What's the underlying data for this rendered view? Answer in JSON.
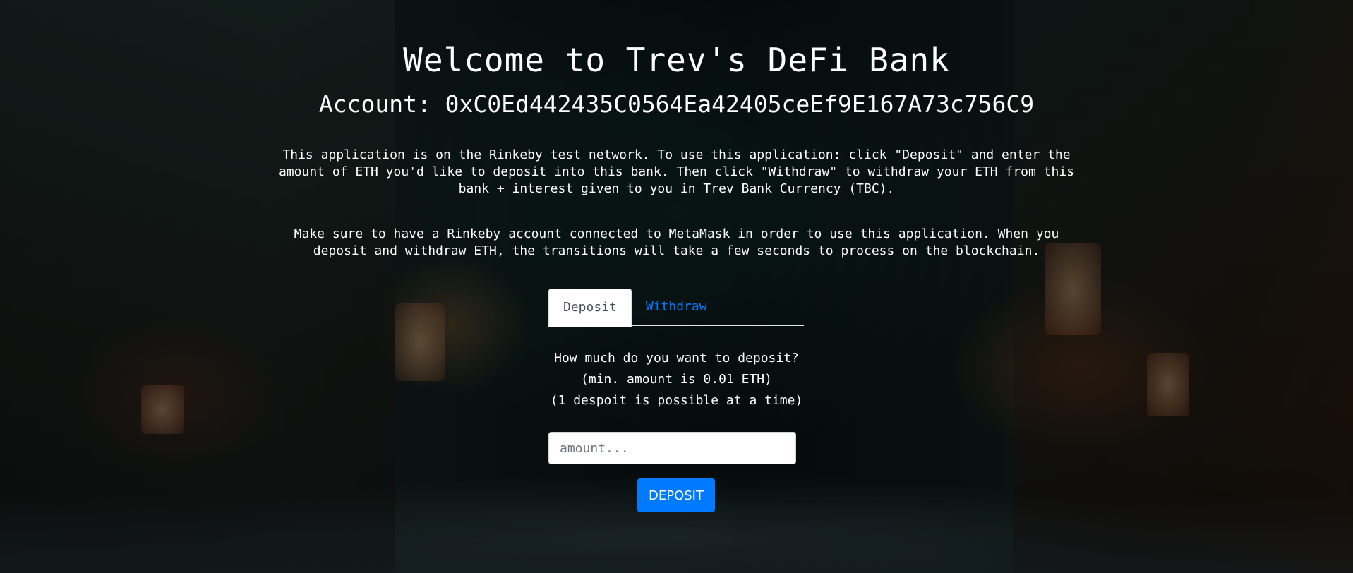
{
  "header": {
    "title": "Welcome to Trev's DeFi Bank",
    "account": "Account: 0xC0Ed442435C0564Ea42405ceEf9E167A73c756C9"
  },
  "info": {
    "paragraph1": "This application is on the Rinkeby test network. To use this application: click \"Deposit\" and enter the amount of ETH you'd like to deposit into this bank. Then click \"Withdraw\" to withdraw your ETH from this bank + interest given to you in Trev Bank Currency (TBC).",
    "paragraph2": "Make sure to have a Rinkeby account connected to MetaMask in order to use this application. When you deposit and withdraw ETH, the transitions will take a few seconds to process on the blockchain."
  },
  "tabs": {
    "deposit_label": "Deposit",
    "withdraw_label": "Withdraw",
    "active": "Deposit"
  },
  "deposit_form": {
    "question": "How much do you want to deposit?",
    "min_note": "(min. amount is 0.01 ETH)",
    "limit_note": "(1 despoit is possible at a time)",
    "amount_placeholder": "amount...",
    "amount_value": "",
    "button_label": "DEPOSIT"
  },
  "colors": {
    "accent": "#007bff",
    "text": "#ffffff"
  }
}
